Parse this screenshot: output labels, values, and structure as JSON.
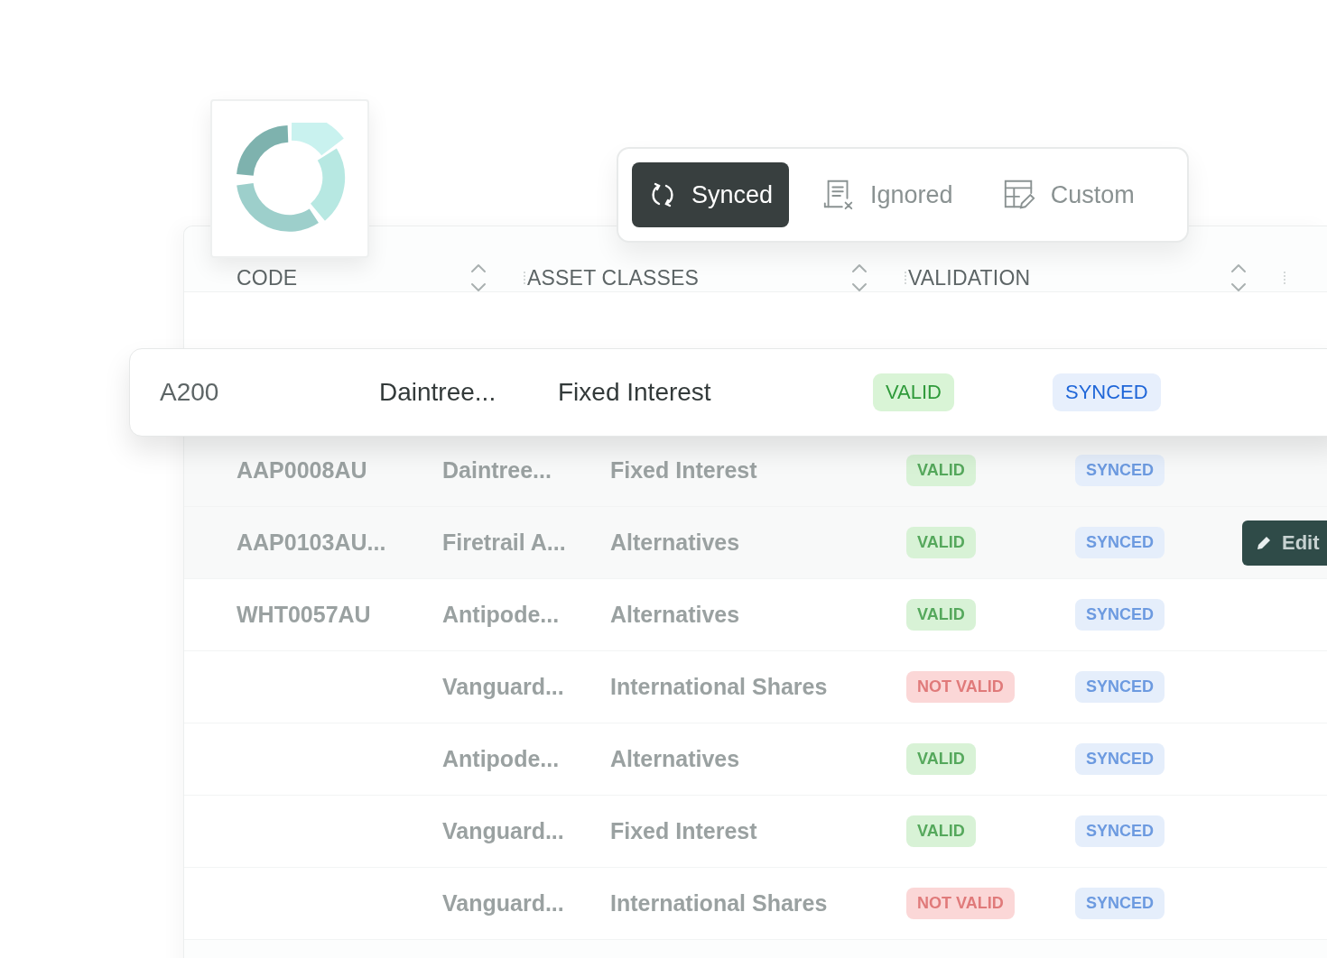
{
  "filter_tabs": [
    {
      "label": "Synced",
      "selected": true
    },
    {
      "label": "Ignored",
      "selected": false
    },
    {
      "label": "Custom",
      "selected": false
    }
  ],
  "table": {
    "columns": [
      {
        "label": "CODE"
      },
      {
        "label": "ASSET CLASSES"
      },
      {
        "label": "VALIDATION"
      }
    ],
    "highlighted_row": {
      "code": "A200",
      "name": "Daintree...",
      "asset_class": "Fixed Interest",
      "validation": {
        "label": "VALID",
        "kind": "valid"
      },
      "sync": "SYNCED"
    },
    "rows": [
      {
        "code": "AAP0008AU",
        "name": "Daintree...",
        "asset_class": "Fixed Interest",
        "validation": {
          "label": "VALID",
          "kind": "valid"
        },
        "sync": "SYNCED"
      },
      {
        "code": "AAP0103AU...",
        "name": "Firetrail A...",
        "asset_class": "Alternatives",
        "validation": {
          "label": "VALID",
          "kind": "valid"
        },
        "sync": "SYNCED",
        "action": "Edit"
      },
      {
        "code": "WHT0057AU",
        "name": "Antipode...",
        "asset_class": "Alternatives",
        "validation": {
          "label": "VALID",
          "kind": "valid"
        },
        "sync": "SYNCED"
      },
      {
        "name": "Vanguard...",
        "asset_class": "International Shares",
        "validation": {
          "label": "NOT VALID",
          "kind": "invalid"
        },
        "sync": "SYNCED"
      },
      {
        "name": "Antipode...",
        "asset_class": "Alternatives",
        "validation": {
          "label": "VALID",
          "kind": "valid"
        },
        "sync": "SYNCED"
      },
      {
        "name": "Vanguard...",
        "asset_class": "Fixed Interest",
        "validation": {
          "label": "VALID",
          "kind": "valid"
        },
        "sync": "SYNCED"
      },
      {
        "name": "Vanguard...",
        "asset_class": "International Shares",
        "validation": {
          "label": "NOT VALID",
          "kind": "invalid"
        },
        "sync": "SYNCED"
      }
    ]
  }
}
